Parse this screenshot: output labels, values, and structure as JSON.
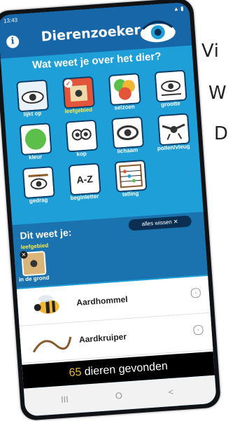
{
  "side_text": [
    "Vi",
    "W",
    "D"
  ],
  "status": {
    "time": "13:43",
    "icons": "▲ ▮"
  },
  "app": {
    "title": "Dierenzoeker",
    "info_label": "i"
  },
  "question": "Wat weet je over het dier?",
  "tiles": [
    {
      "label": "lijkt op",
      "icon": "eye-icon"
    },
    {
      "label": "leefgebied",
      "icon": "habitat-icon",
      "selected": true,
      "badge": "✓"
    },
    {
      "label": "seizoen",
      "icon": "season-icon"
    },
    {
      "label": "grootte",
      "icon": "size-icon"
    },
    {
      "label": "kleur",
      "icon": "color-icon"
    },
    {
      "label": "kop",
      "icon": "head-icon"
    },
    {
      "label": "lichaam",
      "icon": "body-icon"
    },
    {
      "label": "pollen/vleug",
      "icon": "wings-icon"
    },
    {
      "label": "gedrag",
      "icon": "behavior-icon"
    },
    {
      "label": "beginletter",
      "icon": "az-icon",
      "text": "A-Z"
    },
    {
      "label": "telling",
      "icon": "abacus-icon"
    }
  ],
  "known": {
    "title": "Dit weet je:",
    "clear_label": "alles wissen ✕",
    "tag": "leefgebied",
    "item_label": "in de grond",
    "remove_label": "✕"
  },
  "results": [
    {
      "name": "Aardhommel",
      "icon": "bumblebee-icon"
    },
    {
      "name": "Aardkruiper",
      "icon": "worm-icon"
    }
  ],
  "found": {
    "count": "65",
    "text": "dieren gevonden"
  },
  "nav": {
    "recent": "III",
    "home": "O",
    "back": "<"
  },
  "colors": {
    "header": "#1666a8",
    "body": "#1f9fd8",
    "selected": "#e2553a",
    "highlight": "#ffe94d"
  }
}
